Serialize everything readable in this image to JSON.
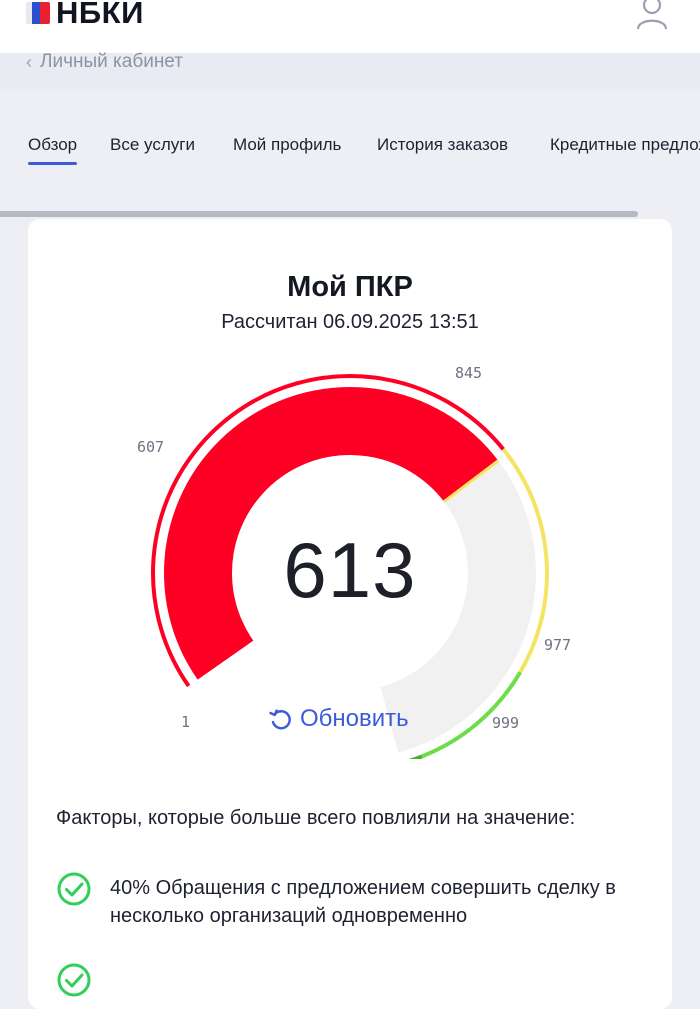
{
  "header": {
    "logo_text": "НБКИ",
    "logo_icon": "nbki-flag-logo",
    "user_icon": "user-profile-icon"
  },
  "breadcrumb": {
    "chevron": "‹",
    "label": "Личный кабинет"
  },
  "tabs": [
    {
      "label": "Обзор",
      "active": true
    },
    {
      "label": "Все услуги",
      "active": false
    },
    {
      "label": "Мой профиль",
      "active": false
    },
    {
      "label": "История заказов",
      "active": false
    },
    {
      "label": "Кредитные предложения",
      "active": false
    }
  ],
  "score_card": {
    "title": "Мой ПКР",
    "calculated": "Рассчитан 06.09.2025 13:51",
    "score": 613,
    "min": 1,
    "max": 999,
    "thresholds": [
      {
        "label": "1",
        "value": 1
      },
      {
        "label": "607",
        "value": 607
      },
      {
        "label": "845",
        "value": 845
      },
      {
        "label": "977",
        "value": 977
      },
      {
        "label": "999",
        "value": 999
      }
    ],
    "zone_colors": {
      "low": "#ff0025",
      "medium": "#f5e463",
      "high": "#6fdc4a",
      "top": "#4caf32"
    },
    "refresh_label": "Обновить",
    "refresh_icon": "refresh-icon"
  },
  "factors": {
    "title": "Факторы, которые больше всего повлияли на значение:",
    "items": [
      {
        "text": "40% Обращения с предложением совершить сделку в несколько организаций одновременно",
        "icon": "check-circle-icon"
      },
      {
        "text": "",
        "icon": "check-circle-icon"
      }
    ]
  }
}
